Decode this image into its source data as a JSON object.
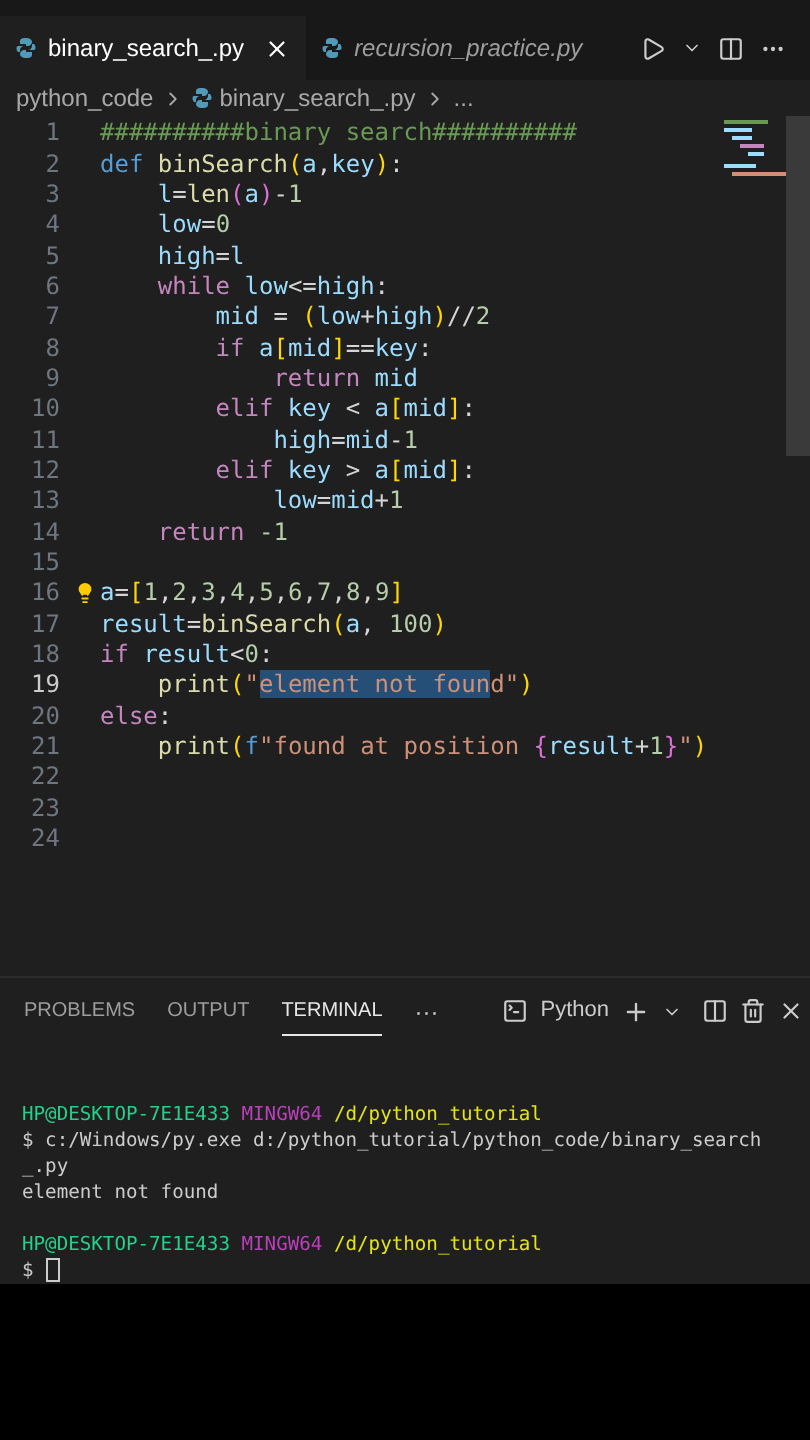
{
  "editor_tabs": [
    {
      "label": "binary_search_.py",
      "selected": true
    },
    {
      "label": "recursion_practice.py",
      "selected": false
    }
  ],
  "breadcrumbs": [
    {
      "label": "python_code",
      "kind": "folder"
    },
    {
      "label": "binary_search_.py",
      "kind": "file"
    },
    {
      "label": "...",
      "kind": "more"
    }
  ],
  "code_lines": [
    {
      "number": "1",
      "current": false,
      "tokens": [
        {
          "text": "##########binary search##########",
          "kind": "comment"
        }
      ]
    },
    {
      "number": "2",
      "current": false,
      "tokens": [
        {
          "text": "def ",
          "kind": "storage"
        },
        {
          "text": "binSearch",
          "kind": "function"
        },
        {
          "text": "(",
          "kind": "bracket"
        },
        {
          "text": "a",
          "kind": "variable"
        },
        {
          "text": ",",
          "kind": "plain"
        },
        {
          "text": "key",
          "kind": "variable"
        },
        {
          "text": ")",
          "kind": "bracket"
        },
        {
          "text": ":",
          "kind": "plain"
        }
      ]
    },
    {
      "number": "3",
      "current": false,
      "tokens": [
        {
          "text": "    l",
          "kind": "variable"
        },
        {
          "text": "=",
          "kind": "plain"
        },
        {
          "text": "len",
          "kind": "function"
        },
        {
          "text": "(",
          "kind": "bracket2"
        },
        {
          "text": "a",
          "kind": "variable"
        },
        {
          "text": ")",
          "kind": "bracket2"
        },
        {
          "text": "-",
          "kind": "plain"
        },
        {
          "text": "1",
          "kind": "number"
        }
      ]
    },
    {
      "number": "4",
      "current": false,
      "tokens": [
        {
          "text": "    low",
          "kind": "variable"
        },
        {
          "text": "=",
          "kind": "plain"
        },
        {
          "text": "0",
          "kind": "number"
        }
      ]
    },
    {
      "number": "5",
      "current": false,
      "tokens": [
        {
          "text": "    high",
          "kind": "variable"
        },
        {
          "text": "=",
          "kind": "plain"
        },
        {
          "text": "l",
          "kind": "variable"
        }
      ]
    },
    {
      "number": "6",
      "current": false,
      "tokens": [
        {
          "text": "    while ",
          "kind": "control"
        },
        {
          "text": "low",
          "kind": "variable"
        },
        {
          "text": "<=",
          "kind": "plain"
        },
        {
          "text": "high",
          "kind": "variable"
        },
        {
          "text": ":",
          "kind": "plain"
        }
      ]
    },
    {
      "number": "7",
      "current": false,
      "tokens": [
        {
          "text": "        mid",
          "kind": "variable"
        },
        {
          "text": " = ",
          "kind": "plain"
        },
        {
          "text": "(",
          "kind": "bracket"
        },
        {
          "text": "low",
          "kind": "variable"
        },
        {
          "text": "+",
          "kind": "plain"
        },
        {
          "text": "high",
          "kind": "variable"
        },
        {
          "text": ")",
          "kind": "bracket"
        },
        {
          "text": "//",
          "kind": "plain"
        },
        {
          "text": "2",
          "kind": "number"
        }
      ]
    },
    {
      "number": "8",
      "current": false,
      "tokens": [
        {
          "text": "        if ",
          "kind": "control"
        },
        {
          "text": "a",
          "kind": "variable"
        },
        {
          "text": "[",
          "kind": "bracket"
        },
        {
          "text": "mid",
          "kind": "variable"
        },
        {
          "text": "]",
          "kind": "bracket"
        },
        {
          "text": "==",
          "kind": "plain"
        },
        {
          "text": "key",
          "kind": "variable"
        },
        {
          "text": ":",
          "kind": "plain"
        }
      ]
    },
    {
      "number": "9",
      "current": false,
      "tokens": [
        {
          "text": "            return ",
          "kind": "control"
        },
        {
          "text": "mid",
          "kind": "variable"
        }
      ]
    },
    {
      "number": "10",
      "current": false,
      "tokens": [
        {
          "text": "        elif ",
          "kind": "control"
        },
        {
          "text": "key",
          "kind": "variable"
        },
        {
          "text": " < ",
          "kind": "plain"
        },
        {
          "text": "a",
          "kind": "variable"
        },
        {
          "text": "[",
          "kind": "bracket"
        },
        {
          "text": "mid",
          "kind": "variable"
        },
        {
          "text": "]",
          "kind": "bracket"
        },
        {
          "text": ":",
          "kind": "plain"
        }
      ]
    },
    {
      "number": "11",
      "current": false,
      "tokens": [
        {
          "text": "            high",
          "kind": "variable"
        },
        {
          "text": "=",
          "kind": "plain"
        },
        {
          "text": "mid",
          "kind": "variable"
        },
        {
          "text": "-",
          "kind": "plain"
        },
        {
          "text": "1",
          "kind": "number"
        }
      ]
    },
    {
      "number": "12",
      "current": false,
      "tokens": [
        {
          "text": "        elif ",
          "kind": "control"
        },
        {
          "text": "key",
          "kind": "variable"
        },
        {
          "text": " > ",
          "kind": "plain"
        },
        {
          "text": "a",
          "kind": "variable"
        },
        {
          "text": "[",
          "kind": "bracket"
        },
        {
          "text": "mid",
          "kind": "variable"
        },
        {
          "text": "]",
          "kind": "bracket"
        },
        {
          "text": ":",
          "kind": "plain"
        }
      ]
    },
    {
      "number": "13",
      "current": false,
      "tokens": [
        {
          "text": "            low",
          "kind": "variable"
        },
        {
          "text": "=",
          "kind": "plain"
        },
        {
          "text": "mid",
          "kind": "variable"
        },
        {
          "text": "+",
          "kind": "plain"
        },
        {
          "text": "1",
          "kind": "number"
        }
      ]
    },
    {
      "number": "14",
      "current": false,
      "tokens": [
        {
          "text": "    return ",
          "kind": "control"
        },
        {
          "text": "-1",
          "kind": "number"
        }
      ]
    },
    {
      "number": "15",
      "current": false
    },
    {
      "number": "16",
      "current": false,
      "lightbulb": true,
      "tokens": [
        {
          "text": "a",
          "kind": "variable"
        },
        {
          "text": "=",
          "kind": "plain"
        },
        {
          "text": "[",
          "kind": "bracket"
        },
        {
          "text": "1",
          "kind": "number"
        },
        {
          "text": ",",
          "kind": "plain"
        },
        {
          "text": "2",
          "kind": "number"
        },
        {
          "text": ",",
          "kind": "plain"
        },
        {
          "text": "3",
          "kind": "number"
        },
        {
          "text": ",",
          "kind": "plain"
        },
        {
          "text": "4",
          "kind": "number"
        },
        {
          "text": ",",
          "kind": "plain"
        },
        {
          "text": "5",
          "kind": "number"
        },
        {
          "text": ",",
          "kind": "plain"
        },
        {
          "text": "6",
          "kind": "number"
        },
        {
          "text": ",",
          "kind": "plain"
        },
        {
          "text": "7",
          "kind": "number"
        },
        {
          "text": ",",
          "kind": "plain"
        },
        {
          "text": "8",
          "kind": "number"
        },
        {
          "text": ",",
          "kind": "plain"
        },
        {
          "text": "9",
          "kind": "number"
        },
        {
          "text": "]",
          "kind": "bracket"
        }
      ]
    },
    {
      "number": "17",
      "current": false,
      "tokens": [
        {
          "text": "result",
          "kind": "variable"
        },
        {
          "text": "=",
          "kind": "plain"
        },
        {
          "text": "binSearch",
          "kind": "function"
        },
        {
          "text": "(",
          "kind": "bracket"
        },
        {
          "text": "a",
          "kind": "variable"
        },
        {
          "text": ", ",
          "kind": "plain"
        },
        {
          "text": "100",
          "kind": "number"
        },
        {
          "text": ")",
          "kind": "bracket"
        }
      ]
    },
    {
      "number": "18",
      "current": false,
      "tokens": [
        {
          "text": "if ",
          "kind": "control"
        },
        {
          "text": "result",
          "kind": "variable"
        },
        {
          "text": "<",
          "kind": "plain"
        },
        {
          "text": "0",
          "kind": "number"
        },
        {
          "text": ":",
          "kind": "plain"
        }
      ]
    },
    {
      "number": "19",
      "current": true,
      "tokens": [
        {
          "text": "    print",
          "kind": "function"
        },
        {
          "text": "(",
          "kind": "bracket"
        },
        {
          "text": "\"",
          "kind": "string"
        },
        {
          "text": "element not foun",
          "kind": "selection"
        },
        {
          "text": "d\"",
          "kind": "string"
        },
        {
          "text": ")",
          "kind": "bracket"
        }
      ]
    },
    {
      "number": "20",
      "current": false,
      "tokens": [
        {
          "text": "else",
          "kind": "control"
        },
        {
          "text": ":",
          "kind": "plain"
        }
      ]
    },
    {
      "number": "21",
      "current": false,
      "tokens": [
        {
          "text": "    print",
          "kind": "function"
        },
        {
          "text": "(",
          "kind": "bracket"
        },
        {
          "text": "f",
          "kind": "storage"
        },
        {
          "text": "\"found at position ",
          "kind": "string"
        },
        {
          "text": "{",
          "kind": "bracket2"
        },
        {
          "text": "result",
          "kind": "variable"
        },
        {
          "text": "+",
          "kind": "plain"
        },
        {
          "text": "1",
          "kind": "number"
        },
        {
          "text": "}",
          "kind": "bracket2"
        },
        {
          "text": "\"",
          "kind": "string"
        },
        {
          "text": ")",
          "kind": "bracket"
        }
      ]
    },
    {
      "number": "22",
      "current": false
    },
    {
      "number": "23",
      "current": false
    },
    {
      "number": "24",
      "current": false
    }
  ],
  "panel_tabs": [
    {
      "label": "PROBLEMS",
      "selected": false
    },
    {
      "label": "OUTPUT",
      "selected": false
    },
    {
      "label": "TERMINAL",
      "selected": true
    }
  ],
  "panel_more": "···",
  "terminal_profile": "Python",
  "terminal_lines": [
    [
      {
        "text": "HP@DESKTOP-7E1E433 ",
        "kind": "user"
      },
      {
        "text": "MINGW64 ",
        "kind": "system"
      },
      {
        "text": "/d/python_tutorial",
        "kind": "path"
      }
    ],
    [
      {
        "text": "$ c:/Windows/py.exe d:/python_tutorial/python_code/binary_search",
        "kind": "plain"
      }
    ],
    [
      {
        "text": "_.py",
        "kind": "plain"
      }
    ],
    [
      {
        "text": "element not found",
        "kind": "plain"
      }
    ],
    [
      {
        "text": "HP@DESKTOP-7E1E433 ",
        "kind": "user"
      },
      {
        "text": "MINGW64 ",
        "kind": "system"
      },
      {
        "text": "/d/python_tutorial",
        "kind": "path"
      }
    ],
    [
      {
        "text": "$",
        "kind": "plain"
      }
    ]
  ],
  "terminal_cursor": true
}
